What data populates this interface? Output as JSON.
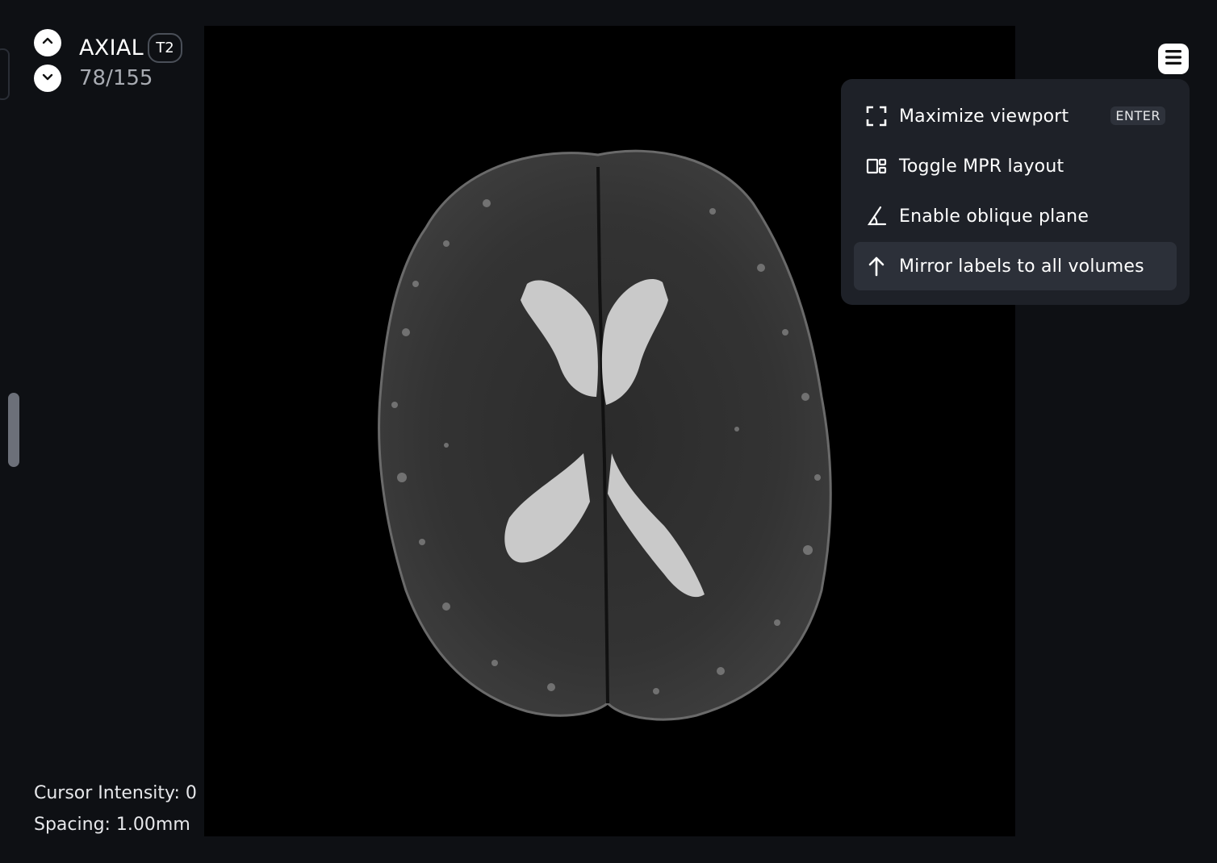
{
  "viewport": {
    "plane": "AXIAL",
    "sequence": "T2",
    "slice_counter": "78/155",
    "cursor_intensity": "Cursor Intensity: 0",
    "spacing": "Spacing: 1.00mm"
  },
  "controls": {
    "prev_slice_icon": "chevron-up-icon",
    "next_slice_icon": "chevron-down-icon",
    "menu_icon": "menu-icon"
  },
  "context_menu": {
    "items": [
      {
        "label": "Maximize viewport",
        "shortcut": "ENTER",
        "icon": "maximize-icon"
      },
      {
        "label": "Toggle MPR layout",
        "icon": "layout-icon"
      },
      {
        "label": "Enable oblique plane",
        "icon": "angle-icon"
      },
      {
        "label": "Mirror labels to all volumes",
        "icon": "arrow-up-icon",
        "highlighted": true
      }
    ]
  },
  "colors": {
    "background": "#0e1014",
    "image_background": "#000000",
    "menu_background": "#1e2128",
    "menu_highlight": "#2c3039"
  }
}
